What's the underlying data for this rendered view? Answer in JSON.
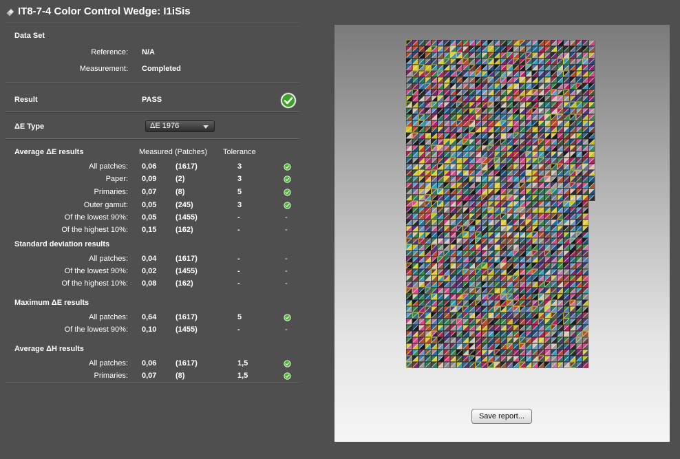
{
  "window": {
    "title": "IT8-7-4 Color Control Wedge: I1iSis",
    "title_icon": "eraser-icon"
  },
  "dataset": {
    "header": "Data Set",
    "reference_label": "Reference:",
    "reference_value": "N/A",
    "measurement_label": "Measurement:",
    "measurement_value": "Completed"
  },
  "result": {
    "label": "Result",
    "value": "PASS",
    "status_icon": "check-circle-icon"
  },
  "de_type": {
    "label": "ΔE Type",
    "selected": "ΔE 1976"
  },
  "columns": {
    "measured": "Measured (Patches)",
    "tolerance": "Tolerance"
  },
  "sections": [
    {
      "header": "Average ΔE results",
      "rows": [
        {
          "label": "All patches:",
          "value": "0,06",
          "patches": "(1617)",
          "tolerance": "3",
          "pass": true
        },
        {
          "label": "Paper:",
          "value": "0,09",
          "patches": "(2)",
          "tolerance": "3",
          "pass": true
        },
        {
          "label": "Primaries:",
          "value": "0,07",
          "patches": "(8)",
          "tolerance": "5",
          "pass": true
        },
        {
          "label": "Outer gamut:",
          "value": "0,05",
          "patches": "(245)",
          "tolerance": "3",
          "pass": true
        },
        {
          "label": "Of the lowest 90%:",
          "value": "0,05",
          "patches": "(1455)",
          "tolerance": "-",
          "status": "-"
        },
        {
          "label": "Of the highest 10%:",
          "value": "0,15",
          "patches": "(162)",
          "tolerance": "-",
          "status": "-"
        }
      ]
    },
    {
      "header": "Standard deviation results",
      "rows": [
        {
          "label": "All patches:",
          "value": "0,04",
          "patches": "(1617)",
          "tolerance": "-",
          "status": "-"
        },
        {
          "label": "Of the lowest 90%:",
          "value": "0,02",
          "patches": "(1455)",
          "tolerance": "-",
          "status": "-"
        },
        {
          "label": "Of the highest 10%:",
          "value": "0,08",
          "patches": "(162)",
          "tolerance": "-",
          "status": "-"
        }
      ]
    },
    {
      "header": "Maximum ΔE results",
      "rows": [
        {
          "label": "All patches:",
          "value": "0,64",
          "patches": "(1617)",
          "tolerance": "5",
          "pass": true
        },
        {
          "label": "Of the lowest 90%:",
          "value": "0,10",
          "patches": "(1455)",
          "tolerance": "-",
          "status": "-"
        }
      ]
    },
    {
      "header": "Average ΔH results",
      "rows": [
        {
          "label": "All patches:",
          "value": "0,06",
          "patches": "(1617)",
          "tolerance": "1,5",
          "pass": true
        },
        {
          "label": "Primaries:",
          "value": "0,07",
          "patches": "(8)",
          "tolerance": "1,5",
          "pass": true
        }
      ]
    }
  ],
  "preview": {
    "save_button": "Save report..."
  },
  "colors": {
    "background": "#4f4f4f",
    "pass_green": "#46b52a",
    "patch_border": "#222222"
  }
}
